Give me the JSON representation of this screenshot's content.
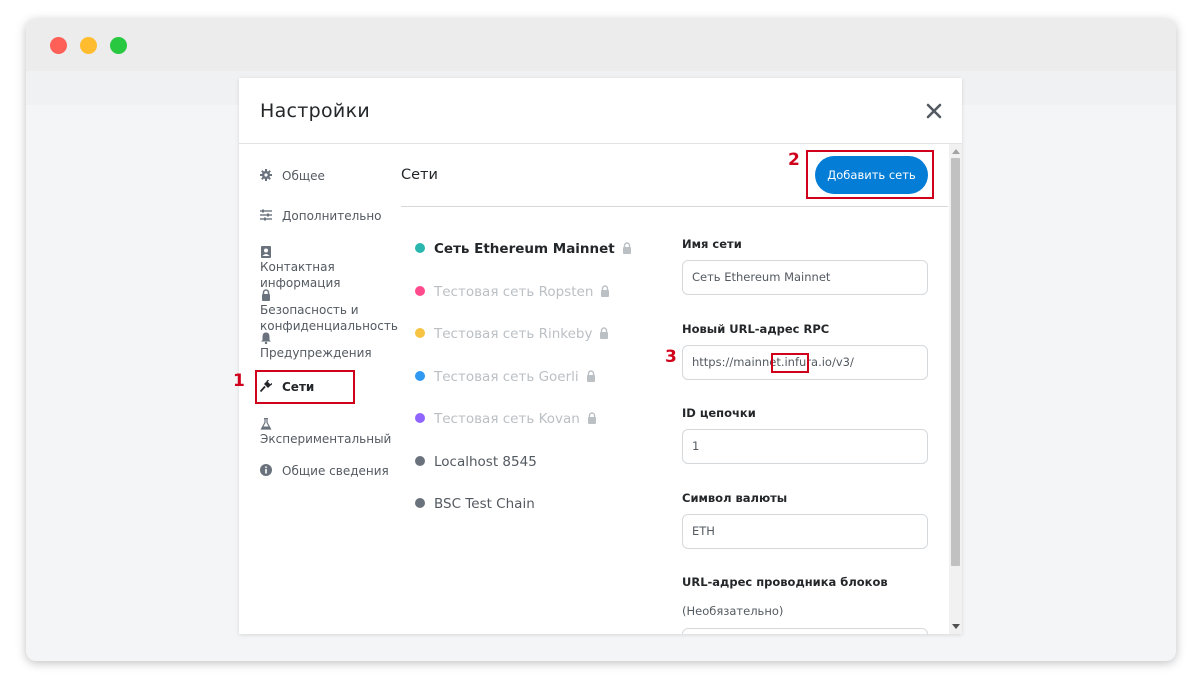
{
  "modal": {
    "title": "Настройки"
  },
  "sidebar": {
    "items": [
      {
        "label": "Общее",
        "icon": "gear-icon"
      },
      {
        "label": "Дополнительно",
        "icon": "sliders-icon"
      },
      {
        "label": "Контактная информация",
        "icon": "contact-book-icon"
      },
      {
        "label": "Безопасность и конфиденциальность",
        "icon": "lock-icon"
      },
      {
        "label": "Предупреждения",
        "icon": "bell-icon"
      },
      {
        "label": "Сети",
        "icon": "plug-icon"
      },
      {
        "label": "Экспериментальный",
        "icon": "flask-icon"
      },
      {
        "label": "Общие сведения",
        "icon": "info-icon"
      }
    ]
  },
  "content": {
    "title": "Сети",
    "add_button": "Добавить сеть"
  },
  "networks": [
    {
      "label": "Сеть Ethereum Mainnet",
      "color": "#29b6af",
      "locked": true
    },
    {
      "label": "Тестовая сеть Ropsten",
      "color": "#ff4a8d",
      "locked": true
    },
    {
      "label": "Тестовая сеть Rinkeby",
      "color": "#f6c343",
      "locked": true
    },
    {
      "label": "Тестовая сеть Goerli",
      "color": "#3099f2",
      "locked": true
    },
    {
      "label": "Тестовая сеть Kovan",
      "color": "#9064ff",
      "locked": true
    },
    {
      "label": "Localhost 8545",
      "color": "#6a737d",
      "locked": false
    },
    {
      "label": "BSC Test Chain",
      "color": "#6a737d",
      "locked": false
    }
  ],
  "form": {
    "network_name": {
      "label": "Имя сети",
      "value": "Сеть Ethereum Mainnet"
    },
    "rpc_url": {
      "label": "Новый URL-адрес RPC",
      "value": "https://mainnet.infura.io/v3/"
    },
    "chain_id": {
      "label": "ID цепочки",
      "value": "1"
    },
    "currency_symbol": {
      "label": "Символ валюты",
      "value": "ETH"
    },
    "explorer_url": {
      "label": "URL-адрес проводника блоков",
      "sublabel": "(Необязательно)",
      "value": ""
    }
  },
  "annotations": [
    "1",
    "2",
    "3"
  ],
  "colors": {
    "accent": "#037dd6",
    "highlight": "#d0021b"
  }
}
